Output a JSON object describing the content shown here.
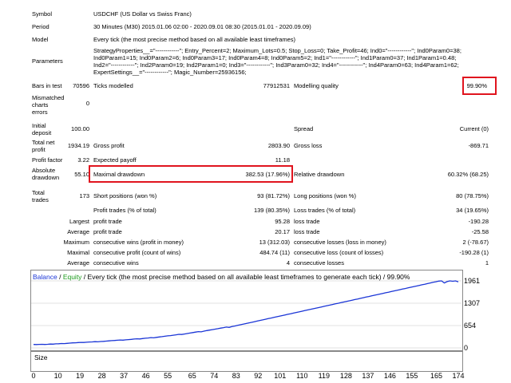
{
  "rows": {
    "symbol": {
      "label": "Symbol",
      "value": "USDCHF (US Dollar vs Swiss Franc)"
    },
    "period": {
      "label": "Period",
      "value": "30 Minutes (M30) 2015.01.06 02:00 - 2020.09.01 08:30 (2015.01.01 - 2020.09.09)"
    },
    "model": {
      "label": "Model",
      "value": "Every tick (the most precise method based on all available least timeframes)"
    },
    "parameters": {
      "label": "Parameters",
      "lines": [
        "StrategyProperties__=\"------------\"; Entry_Percent=2; Maximum_Lots=0.5; Stop_Loss=0; Take_Profit=46; Ind0=\"------------\"; Ind0Param0=38;",
        "Ind0Param1=15; Ind0Param2=6; Ind0Param3=17; Ind0Param4=8; Ind0Param5=2; Ind1=\"------------\"; Ind1Param0=37; Ind1Param1=0.48;",
        "Ind2=\"------------\"; Ind2Param0=19; Ind2Param1=0; Ind3=\"------------\"; Ind3Param0=32; Ind4=\"------------\"; Ind4Param0=63; Ind4Param1=62;",
        "ExpertSettings__=\"------------\"; Magic_Number=25936156;"
      ]
    },
    "bars": {
      "label": "Bars in test",
      "value": "70596",
      "ticks_label": "Ticks modelled",
      "ticks_value": "77912531",
      "quality_label": "Modelling quality",
      "quality_value": "99.90%"
    },
    "mismatched": {
      "label_lines": [
        "Mismatched",
        "charts",
        "errors"
      ],
      "value": "0"
    },
    "initial": {
      "label_lines": [
        "Initial",
        "deposit"
      ],
      "value": "100.00",
      "spread_label": "Spread",
      "spread_value": "Current (0)"
    },
    "net_profit": {
      "label_lines": [
        "Total net",
        "profit"
      ],
      "value": "1934.19",
      "gp_label": "Gross profit",
      "gp_value": "2803.90",
      "gl_label": "Gross loss",
      "gl_value": "-869.71"
    },
    "profit_factor": {
      "label": "Profit factor",
      "value": "3.22",
      "ep_label": "Expected payoff",
      "ep_value": "11.18"
    },
    "abs_dd": {
      "label_lines": [
        "Absolute",
        "drawdown"
      ],
      "value": "55.10",
      "md_label": "Maximal drawdown",
      "md_value": "382.53 (17.96%)",
      "rd_label": "Relative drawdown",
      "rd_value": "60.32% (68.25)"
    },
    "total_trades": {
      "label_lines": [
        "Total",
        "trades"
      ],
      "value": "173",
      "sp_label": "Short positions (won %)",
      "sp_value": "93 (81.72%)",
      "lp_label": "Long positions (won %)",
      "lp_value": "80 (78.75%)"
    },
    "profit_trades": {
      "label": "Profit trades (% of total)",
      "value": "139 (80.35%)",
      "loss_label": "Loss trades (% of total)",
      "loss_value": "34 (19.65%)"
    },
    "largest": {
      "prefix": "Largest",
      "label": "profit trade",
      "value": "95.28",
      "loss_label": "loss trade",
      "loss_value": "-190.28"
    },
    "average": {
      "prefix": "Average",
      "label": "profit trade",
      "value": "20.17",
      "loss_label": "loss trade",
      "loss_value": "-25.58"
    },
    "max_cons": {
      "prefix": "Maximum",
      "label": "consecutive wins (profit in money)",
      "value": "13 (312.03)",
      "loss_label": "consecutive losses (loss in money)",
      "loss_value": "2 (-78.67)"
    },
    "maximal_cons": {
      "prefix": "Maximal",
      "label": "consecutive profit (count of wins)",
      "value": "484.74 (11)",
      "loss_label": "consecutive loss (count of losses)",
      "loss_value": "-190.28 (1)"
    },
    "avg_cons": {
      "prefix": "Average",
      "label": "consecutive wins",
      "value": "4",
      "loss_label": "consecutive losses",
      "loss_value": "1"
    }
  },
  "chart_title": {
    "balance": "Balance",
    "sep": " / ",
    "equity": "Equity",
    "rest": " / Every tick (the most precise method based on all available least timeframes to generate each tick) / 99.90%"
  },
  "colors": {
    "balance": "#1a35d6",
    "equity": "#1c9b1c",
    "highlight": "#e0141e"
  },
  "size_label": "Size",
  "chart_data": {
    "type": "line",
    "series": [
      {
        "name": "Balance",
        "values": [
          100,
          98,
          102,
          104,
          101,
          105,
          112,
          110,
          118,
          122,
          128,
          126,
          132,
          140,
          148,
          150,
          156,
          160,
          158,
          166,
          172,
          176,
          182,
          178,
          186,
          192,
          198,
          205,
          212,
          218,
          224,
          230,
          226,
          235,
          242,
          250,
          258,
          266,
          262,
          272,
          282,
          290,
          300,
          295,
          308,
          320,
          330,
          342,
          352,
          360,
          372,
          384,
          396,
          392,
          406,
          420,
          434,
          448,
          462,
          476,
          470,
          490,
          506,
          520,
          534,
          548,
          562,
          578,
          594,
          610,
          600,
          624,
          640,
          658,
          676,
          694,
          712,
          730,
          748,
          766,
          784,
          802,
          820,
          838,
          856,
          874,
          892,
          910,
          928,
          946,
          964,
          982,
          1000,
          1018,
          1036,
          1054,
          1072,
          1090,
          1108,
          1126,
          1144,
          1162,
          1180,
          1198,
          1216,
          1234,
          1252,
          1270,
          1288,
          1306,
          1324,
          1342,
          1360,
          1378,
          1396,
          1414,
          1432,
          1450,
          1468,
          1486,
          1504,
          1522,
          1540,
          1558,
          1576,
          1594,
          1612,
          1630,
          1648,
          1666,
          1684,
          1702,
          1720,
          1738,
          1756,
          1774,
          1792,
          1810,
          1828,
          1846,
          1864,
          1882,
          1900,
          1918,
          1936,
          1954,
          1961,
          1900,
          1940,
          1960,
          1950,
          1961,
          1934
        ]
      },
      {
        "name": "Equity",
        "values": []
      }
    ],
    "y_ticks": [
      "1961",
      "1307",
      "654",
      "0"
    ],
    "ylim": [
      0,
      1961
    ],
    "x_ticks": [
      "0",
      "10",
      "19",
      "28",
      "37",
      "46",
      "55",
      "65",
      "74",
      "83",
      "92",
      "101",
      "110",
      "119",
      "128",
      "137",
      "146",
      "155",
      "165",
      "174"
    ],
    "xlim": [
      0,
      174
    ],
    "size_panel": {
      "label": "Size"
    }
  }
}
